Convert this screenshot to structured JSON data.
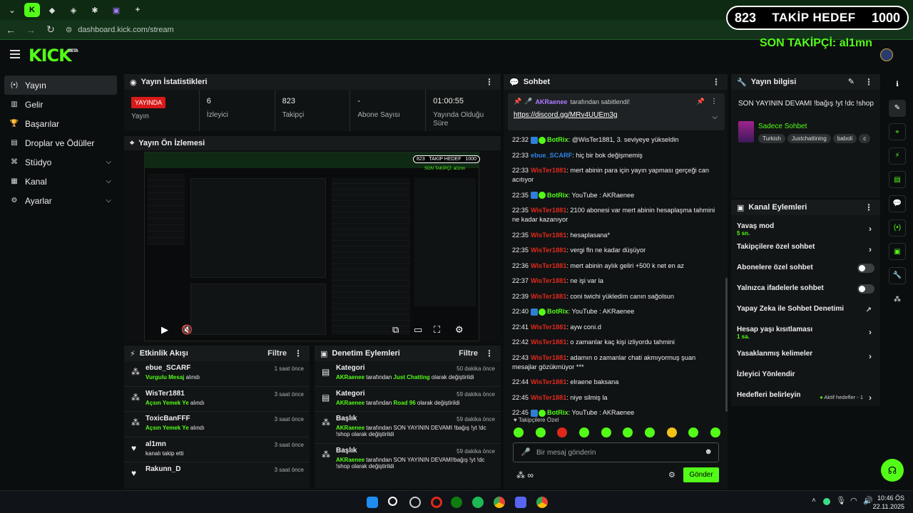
{
  "browser": {
    "url": "dashboard.kick.com/stream",
    "tabs": [
      {
        "label": "K"
      },
      {
        "label": "◆"
      },
      {
        "label": "◈"
      },
      {
        "label": "✱"
      },
      {
        "label": "▣"
      }
    ],
    "new_tab": "+"
  },
  "overlay": {
    "count": "823",
    "label": "TAKİP HEDEF",
    "goal": "1000",
    "last_follower": "SON TAKİPÇİ: al1mn"
  },
  "header": {
    "logo": "KICK",
    "beta": "BETA"
  },
  "sidebar": {
    "items": [
      {
        "label": "Yayın",
        "icon": "broadcast-icon"
      },
      {
        "label": "Gelir",
        "icon": "revenue-icon"
      },
      {
        "label": "Başarılar",
        "icon": "trophy-icon"
      },
      {
        "label": "Droplar ve Ödüller",
        "icon": "gift-icon"
      },
      {
        "label": "Stüdyo",
        "icon": "studio-icon"
      },
      {
        "label": "Kanal",
        "icon": "channel-icon"
      },
      {
        "label": "Ayarlar",
        "icon": "gear-icon"
      }
    ]
  },
  "stats": {
    "title": "Yayın İstatistikleri",
    "live_badge": "YAYINDA",
    "live_label": "Yayın",
    "items": [
      {
        "value": "6",
        "label": "İzleyici"
      },
      {
        "value": "823",
        "label": "Takipçi"
      },
      {
        "value": "-",
        "label": "Abone Sayısı"
      },
      {
        "value": "01:00:55",
        "label": "Yayında Olduğu Süre"
      }
    ]
  },
  "preview": {
    "title": "Yayın Ön İzlemesi",
    "inner_overlay": "823   TAKİP HEDEF   1000",
    "inner_sub": "SON TAKİPÇİ: al1mn"
  },
  "activity": {
    "title": "Etkinlik Akışı",
    "filter": "Filtre",
    "items": [
      {
        "user": "ebue_SCARF",
        "detail_green": "Vurgulu Mesaj",
        "detail": "alındı",
        "time": "1 saat önce"
      },
      {
        "user": "WisTer1881",
        "detail_green": "Açsın Yemek Ye",
        "detail": "alındı",
        "time": "3 saat önce"
      },
      {
        "user": "ToxicBanFFF",
        "detail_green": "Açsın Yemek Ye",
        "detail": "alındı",
        "time": "3 saat önce"
      },
      {
        "user": "al1mn",
        "detail_green": "",
        "detail": "kanalı takip etti",
        "time": "3 saat önce"
      },
      {
        "user": "Rakunn_D",
        "detail_green": "",
        "detail": "",
        "time": "3 saat önce"
      }
    ]
  },
  "moderation": {
    "title": "Denetim Eylemleri",
    "filter": "Filtre",
    "items": [
      {
        "type": "Kategori",
        "actor": "AKRaenee",
        "mid": "tarafından",
        "target": "Just Chatting",
        "end": "olarak değiştirildi",
        "time": "50 dakika önce"
      },
      {
        "type": "Kategori",
        "actor": "AKRaenee",
        "mid": "tarafından",
        "target": "Road 96",
        "end": "olarak değiştirildi",
        "time": "59 dakika önce"
      },
      {
        "type": "Başlık",
        "actor": "AKRaenee",
        "mid": "tarafından SON YAYININ DEVAMI !bağış !yt !dc !shop olarak değiştirildi",
        "target": "",
        "end": "",
        "time": "59 dakika önce"
      },
      {
        "type": "Başlık",
        "actor": "AKRaenee",
        "mid": "tarafından SON YAYININ DEVAMI!bağış !yt !dc !shop olarak değiştirildi",
        "target": "",
        "end": "",
        "time": "59 dakika önce"
      }
    ]
  },
  "chat": {
    "title": "Sohbet",
    "pinned_by": "AKRaenee",
    "pinned_suffix": "tarafından sabitlendi!",
    "pinned_link": "https://discord.gg/MRv4UUEm3g",
    "messages": [
      {
        "time": "22:32",
        "user": "BotRix",
        "color": "grn",
        "badges": 2,
        "text": ": @WisTer1881, 3. seviyeye yükseldin"
      },
      {
        "time": "22:33",
        "user": "ebue_SCARF",
        "color": "blu",
        "badges": 0,
        "text": ": hiç bir bok değişmemiş"
      },
      {
        "time": "22:33",
        "user": "WisTer1881",
        "color": "red",
        "badges": 0,
        "text": ": mert abinin para için yayın yapması gerçeği can acıtıyor"
      },
      {
        "time": "22:35",
        "user": "BotRix",
        "color": "grn",
        "badges": 2,
        "text": ": YouTube : AKRaenee"
      },
      {
        "time": "22:35",
        "user": "WisTer1881",
        "color": "red",
        "badges": 0,
        "text": ": 2100 abonesi var mert abinin hesaplaşma tahmini ne kadar kazanıyor"
      },
      {
        "time": "22:35",
        "user": "WisTer1881",
        "color": "red",
        "badges": 0,
        "text": ": hesaplasana*"
      },
      {
        "time": "22:35",
        "user": "WisTer1881",
        "color": "red",
        "badges": 0,
        "text": ": vergi fln ne kadar düşüyor"
      },
      {
        "time": "22:36",
        "user": "WisTer1881",
        "color": "red",
        "badges": 0,
        "text": ": mert abinin aylık geliri +500 k net en az"
      },
      {
        "time": "22:37",
        "user": "WisTer1881",
        "color": "red",
        "badges": 0,
        "text": ": ne işi var la"
      },
      {
        "time": "22:39",
        "user": "WisTer1881",
        "color": "red",
        "badges": 0,
        "text": ": coni twichi yükledim canın sağolsun"
      },
      {
        "time": "22:40",
        "user": "BotRix",
        "color": "grn",
        "badges": 2,
        "text": ": YouTube : AKRaenee"
      },
      {
        "time": "22:41",
        "user": "WisTer1881",
        "color": "red",
        "badges": 0,
        "text": ": ayw coni.d"
      },
      {
        "time": "22:42",
        "user": "WisTer1881",
        "color": "red",
        "badges": 0,
        "text": ": o zamanlar kaç kişi izliyordu tahmini"
      },
      {
        "time": "22:43",
        "user": "WisTer1881",
        "color": "red",
        "badges": 0,
        "text": ": adamın o zamanlar chati akmıyormuş şuan mesajlar gözükmüyor ***"
      },
      {
        "time": "22:44",
        "user": "WisTer1881",
        "color": "red",
        "badges": 0,
        "text": ": elraene baksana"
      },
      {
        "time": "22:45",
        "user": "WisTer1881",
        "color": "red",
        "badges": 0,
        "text": ": niye silmiş la"
      },
      {
        "time": "22:45",
        "user": "BotRix",
        "color": "grn",
        "badges": 2,
        "text": ": YouTube : AKRaenee"
      }
    ],
    "followers_only": "Takipçilere Özel",
    "input_placeholder": "Bir mesaj gönderin",
    "send_label": "Gönder"
  },
  "stream_info": {
    "title": "Yayın bilgisi",
    "stream_title": "SON YAYININ DEVAMI !bağış !yt !dc !shop",
    "category": "Sadece Sohbet",
    "tags": [
      "Turkish",
      "Justchattining",
      "baboli",
      "c"
    ]
  },
  "channel_actions": {
    "title": "Kanal Eylemleri",
    "items": [
      {
        "label": "Yavaş mod",
        "sub": "5 sn.",
        "control": "chevron"
      },
      {
        "label": "Takipçilere özel sohbet",
        "sub": "",
        "control": "chevron"
      },
      {
        "label": "Abonelere özel sohbet",
        "sub": "",
        "control": "toggle"
      },
      {
        "label": "Yalnızca ifadelerle sohbet",
        "sub": "",
        "control": "toggle"
      },
      {
        "label": "Yapay Zeka ile Sohbet Denetimi",
        "sub": "",
        "control": "external"
      },
      {
        "label": "Hesap yaşı kısıtlaması",
        "sub": "1 sa.",
        "control": "chevron"
      },
      {
        "label": "Yasaklanmış kelimeler",
        "sub": "",
        "control": "chevron"
      },
      {
        "label": "İzleyici Yönlendir",
        "sub": "",
        "control": "none"
      },
      {
        "label": "Hedefleri belirleyin",
        "sub": "",
        "control": "chevron"
      }
    ],
    "active_goals": "Aktif hedefler - 1"
  },
  "taskbar": {
    "time": "10:46 ÖS",
    "date": "22.11.2025"
  }
}
